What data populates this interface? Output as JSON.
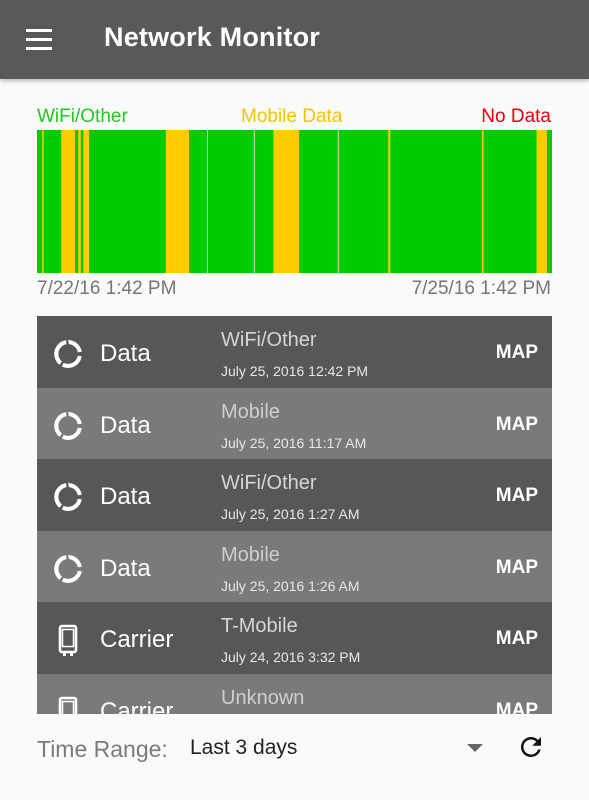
{
  "app": {
    "title": "Network Monitor"
  },
  "legend": {
    "wifi": "WiFi/Other",
    "mobile": "Mobile Data",
    "no_data": "No Data"
  },
  "colors": {
    "wifi": "#00cc00",
    "mobile": "#ffcc00",
    "no_data": "#ff0000",
    "divider": "#cfd8cf"
  },
  "timeline": {
    "start_label": "7/22/16 1:42 PM",
    "end_label": "7/25/16 1:42 PM",
    "segments": [
      {
        "type": "wifi",
        "start": 0.0,
        "end": 0.01
      },
      {
        "type": "mobile",
        "start": 0.01,
        "end": 0.013
      },
      {
        "type": "wifi",
        "start": 0.013,
        "end": 0.047
      },
      {
        "type": "mobile",
        "start": 0.047,
        "end": 0.074
      },
      {
        "type": "wifi",
        "start": 0.074,
        "end": 0.08
      },
      {
        "type": "mobile",
        "start": 0.08,
        "end": 0.085
      },
      {
        "type": "wifi",
        "start": 0.085,
        "end": 0.09
      },
      {
        "type": "mobile",
        "start": 0.09,
        "end": 0.101
      },
      {
        "type": "wifi",
        "start": 0.101,
        "end": 0.25
      },
      {
        "type": "mobile",
        "start": 0.25,
        "end": 0.295
      },
      {
        "type": "wifi",
        "start": 0.295,
        "end": 0.398
      },
      {
        "type": "wifi",
        "start": 0.398,
        "end": 0.398
      },
      {
        "type": "wifi",
        "start": 0.398,
        "end": 0.398
      },
      {
        "type": "wifi",
        "start": 0.398,
        "end": 0.398
      },
      {
        "type": "wifi",
        "start": 0.398,
        "end": 0.398
      },
      {
        "type": "wifi",
        "start": 0.398,
        "end": 0.398
      },
      {
        "type": "wifi",
        "start": 0.398,
        "end": 0.398
      },
      {
        "type": "mobile",
        "start": 0.398,
        "end": 0.398
      },
      {
        "type": "wifi",
        "start": 0.398,
        "end": 0.398
      },
      {
        "type": "wifi",
        "start": 0.398,
        "end": 0.398
      },
      {
        "type": "wifi",
        "start": 0.398,
        "end": 0.398
      },
      {
        "type": "wifi",
        "start": 0.398,
        "end": 0.398
      },
      {
        "type": "wifi",
        "start": 0.398,
        "end": 0.398
      },
      {
        "type": "wifi",
        "start": 0.398,
        "end": 0.398
      },
      {
        "type": "wifi",
        "start": 0.398,
        "end": 0.398
      },
      {
        "type": "wifi",
        "start": 0.398,
        "end": 0.398
      },
      {
        "type": "wifi",
        "start": 0.398,
        "end": 0.398
      },
      {
        "type": "mobile",
        "start": 0.398,
        "end": 0.398
      },
      {
        "type": "mobile",
        "start": 0.398,
        "end": 0.398
      },
      {
        "type": "wifi",
        "start": 0.398,
        "end": 0.398
      },
      {
        "type": "mobile",
        "start": 0.398,
        "end": 0.398
      },
      {
        "type": "wifi",
        "start": 0.398,
        "end": 0.398
      },
      {
        "type": "mobile",
        "start": 0.398,
        "end": 0.398
      },
      {
        "type": "wifi",
        "start": 0.398,
        "end": 0.398
      },
      {
        "type": "mobile",
        "start": 0.398,
        "end": 0.398
      },
      {
        "type": "wifi",
        "start": 0.398,
        "end": 0.398
      },
      {
        "type": "wifi",
        "start": 0.398,
        "end": 0.398
      },
      {
        "type": "mobile",
        "start": 0.398,
        "end": 0.398
      },
      {
        "type": "wifi",
        "start": 0.398,
        "end": 0.398
      },
      {
        "type": "wifi",
        "start": 0.398,
        "end": 0.398
      },
      {
        "type": "wifi",
        "start": 0.398,
        "end": 0.398
      },
      {
        "type": "mobile",
        "start": 0.398,
        "end": 0.398
      },
      {
        "type": "wifi",
        "start": 0.398,
        "end": 0.398
      },
      {
        "type": "wifi",
        "start": 0.398,
        "end": 0.398
      },
      {
        "type": "wifi",
        "start": 0.398,
        "end": 0.398
      },
      {
        "type": "wifi",
        "start": 0.398,
        "end": 0.398
      },
      {
        "type": "wifi",
        "start": 0.398,
        "end": 0.398
      },
      {
        "type": "mobile",
        "start": 0.398,
        "end": 0.398
      },
      {
        "type": "mobile",
        "start": 0.398,
        "end": 0.398
      },
      {
        "type": "mobile",
        "start": 0.398,
        "end": 0.398
      },
      {
        "type": "wifi",
        "start": 0.398,
        "end": 0.398
      },
      {
        "type": "wifi",
        "start": 0.398,
        "end": 0.398
      },
      {
        "type": "mobile",
        "start": 0.398,
        "end": 0.398
      },
      {
        "type": "wifi",
        "start": 0.398,
        "end": 0.398
      },
      {
        "type": "wifi",
        "start": 0.398,
        "end": 0.398
      },
      {
        "type": "wifi",
        "start": 0.398,
        "end": 0.398
      },
      {
        "type": "wifi",
        "start": 0.398,
        "end": 0.398
      },
      {
        "type": "wifi",
        "start": 0.398,
        "end": 0.398
      },
      {
        "type": "wifi",
        "start": 0.398,
        "end": 0.398
      },
      {
        "type": "wifi",
        "start": 0.398,
        "end": 0.398
      },
      {
        "type": "wifi",
        "start": 0.398,
        "end": 0.398
      },
      {
        "type": "wifi",
        "start": 0.398,
        "end": 0.398
      },
      {
        "type": "wifi",
        "start": 0.398,
        "end": 0.398
      },
      {
        "type": "wifi",
        "start": 0.398,
        "end": 0.398
      },
      {
        "type": "wifi",
        "start": 0.398,
        "end": 0.398
      },
      {
        "type": "wifi",
        "start": 0.398,
        "end": 0.398
      },
      {
        "type": "wifi",
        "start": 0.398,
        "end": 0.398
      },
      {
        "type": "wifi",
        "start": 0.398,
        "end": 0.398
      },
      {
        "type": "wifi",
        "start": 0.398,
        "end": 0.398
      },
      {
        "type": "wifi",
        "start": 0.398,
        "end": 0.398
      },
      {
        "type": "wifi",
        "start": 0.398,
        "end": 0.398
      },
      {
        "type": "wifi",
        "start": 0.398,
        "end": 0.398
      },
      {
        "type": "wifi",
        "start": 0.398,
        "end": 0.398
      },
      {
        "type": "wifi",
        "start": 0.398,
        "end": 0.398
      },
      {
        "type": "wifi",
        "start": 0.398,
        "end": 0.398
      },
      {
        "type": "wifi",
        "start": 0.398,
        "end": 0.398
      },
      {
        "type": "wifi",
        "start": 0.398,
        "end": 0.398
      },
      {
        "type": "wifi",
        "start": 0.398,
        "end": 0.398
      },
      {
        "type": "wifi",
        "start": 0.398,
        "end": 0.398
      },
      {
        "type": "wifi",
        "start": 0.398,
        "end": 0.398
      },
      {
        "type": "wifi",
        "start": 0.398,
        "end": 0.398
      },
      {
        "type": "wifi",
        "start": 0.398,
        "end": 0.398
      },
      {
        "type": "wifi",
        "start": 0.398,
        "end": 0.398
      },
      {
        "type": "wifi",
        "start": 0.398,
        "end": 0.398
      },
      {
        "type": "wifi",
        "start": 0.398,
        "end": 0.398
      },
      {
        "type": "wifi",
        "start": 0.398,
        "end": 0.398
      },
      {
        "type": "wifi",
        "start": 0.398,
        "end": 0.398
      },
      {
        "type": "wifi",
        "start": 0.398,
        "end": 0.398
      },
      {
        "type": "wifi",
        "start": 0.398,
        "end": 0.398
      },
      {
        "type": "wifi",
        "start": 0.398,
        "end": 0.398
      },
      {
        "type": "wifi",
        "start": 0.398,
        "end": 0.398
      },
      {
        "type": "wifi",
        "start": 0.398,
        "end": 0.398
      },
      {
        "type": "wifi",
        "start": 0.398,
        "end": 0.398
      },
      {
        "type": "wifi",
        "start": 0.398,
        "end": 0.398
      },
      {
        "type": "wifi",
        "start": 0.398,
        "end": 0.398
      },
      {
        "type": "wifi",
        "start": 0.398,
        "end": 0.398
      },
      {
        "type": "wifi",
        "start": 0.398,
        "end": 0.398
      },
      {
        "type": "wifi",
        "start": 0.398,
        "end": 0.398
      },
      {
        "type": "wifi",
        "start": 0.398,
        "end": 0.398
      },
      {
        "type": "wifi",
        "start": 0.398,
        "end": 0.398
      }
    ]
  },
  "entries": [
    {
      "icon": "data-circle-icon",
      "type": "Data",
      "network": "WiFi/Other",
      "time": "July 25, 2016 12:42 PM",
      "action": "MAP"
    },
    {
      "icon": "data-circle-icon",
      "type": "Data",
      "network": "Mobile",
      "time": "July 25, 2016 11:17 AM",
      "action": "MAP"
    },
    {
      "icon": "data-circle-icon",
      "type": "Data",
      "network": "WiFi/Other",
      "time": "July 25, 2016 1:27 AM",
      "action": "MAP"
    },
    {
      "icon": "data-circle-icon",
      "type": "Data",
      "network": "Mobile",
      "time": "July 25, 2016 1:26 AM",
      "action": "MAP"
    },
    {
      "icon": "phone-icon",
      "type": "Carrier",
      "network": "T-Mobile",
      "time": "July 24, 2016 3:32 PM",
      "action": "MAP"
    },
    {
      "icon": "phone-icon",
      "type": "Carrier",
      "network": "Unknown",
      "time": "",
      "action": "MAP"
    }
  ],
  "footer": {
    "time_range_label": "Time Range:",
    "time_range_value": "Last 3 days"
  }
}
